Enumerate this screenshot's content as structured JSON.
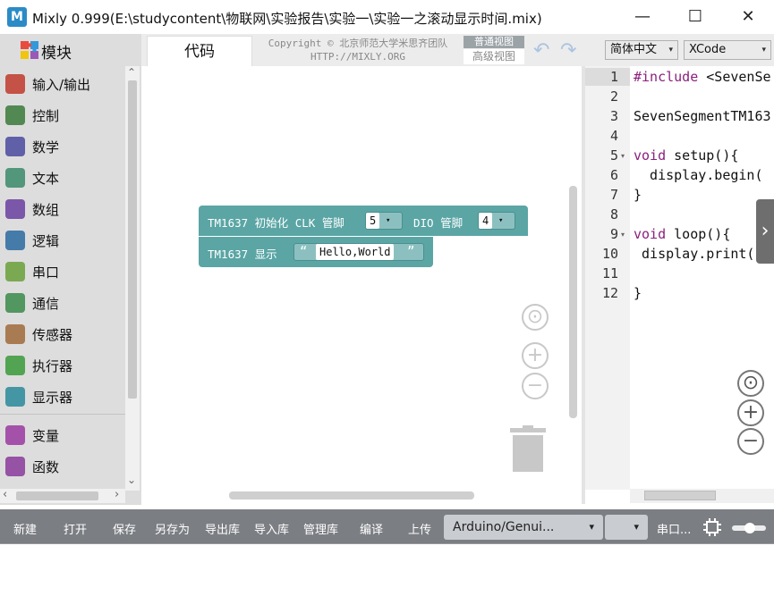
{
  "window": {
    "title": "Mixly 0.999(E:\\studycontent\\物联网\\实验报告\\实验一\\实验一之滚动显示时间.mix)",
    "app_icon": "M",
    "minimize": "—",
    "maximize": "☐",
    "close": "✕"
  },
  "sidebar": {
    "header": "模块",
    "categories": [
      {
        "label": "输入/输出",
        "icon": "io-arrows-icon",
        "color": "#c0392b"
      },
      {
        "label": "控制",
        "icon": "gamepad-icon",
        "color": "#3a7a3a"
      },
      {
        "label": "数学",
        "icon": "sigma-icon",
        "color": "#4a4aa0"
      },
      {
        "label": "文本",
        "icon": "text-t-icon",
        "color": "#3a8a6a"
      },
      {
        "label": "数组",
        "icon": "array-blocks-icon",
        "color": "#6a3fa0"
      },
      {
        "label": "逻辑",
        "icon": "lightbulb-icon",
        "color": "#2a6aa0"
      },
      {
        "label": "串口",
        "icon": "plug-icon",
        "color": "#6aa03a"
      },
      {
        "label": "通信",
        "icon": "satellite-icon",
        "color": "#3a8a4a"
      },
      {
        "label": "传感器",
        "icon": "sensor-wave-icon",
        "color": "#a06a3a"
      },
      {
        "label": "执行器",
        "icon": "actuator-icon",
        "color": "#3a9a3a"
      },
      {
        "label": "显示器",
        "icon": "monitor-icon",
        "color": "#2a8a9a"
      },
      {
        "label": "变量",
        "icon": "variable-cube-icon",
        "color": "#9a3aa0"
      },
      {
        "label": "函数",
        "icon": "function-xy-icon",
        "color": "#8a3a9a"
      }
    ],
    "scroll_up": "⌃",
    "scroll_down": "⌄",
    "scroll_left": "‹",
    "scroll_right": "›"
  },
  "tabs": {
    "code": "代码",
    "copyright_line1": "Copyright © 北京师范大学米思齐团队",
    "copyright_line2": "HTTP://MIXLY.ORG",
    "view_normal": "普通视图",
    "view_advanced": "高级视图",
    "undo": "↶",
    "redo": "↷"
  },
  "blocks": {
    "init": {
      "prefix": "TM1637 初始化 CLK 管脚",
      "clk_value": "5",
      "dio_label": "DIO 管脚",
      "dio_value": "4",
      "caret": "▾"
    },
    "display": {
      "prefix": "TM1637 显示",
      "open_quote": "“",
      "text": "Hello,World",
      "close_quote": "”"
    }
  },
  "workspace_controls": {
    "center": "⊙",
    "zoom_in": "+",
    "zoom_out": "−"
  },
  "code_panel": {
    "language": "简体中文",
    "theme": "XCode",
    "caret": "▾",
    "line_numbers": [
      "1",
      "2",
      "3",
      "4",
      "5",
      "6",
      "7",
      "8",
      "9",
      "10",
      "11",
      "12"
    ],
    "lines": [
      {
        "keyword": "#include",
        "rest": " <SevenSe"
      },
      {
        "keyword": "",
        "rest": ""
      },
      {
        "keyword": "",
        "rest": "SevenSegmentTM163"
      },
      {
        "keyword": "",
        "rest": ""
      },
      {
        "keyword": "void",
        "rest": " setup(){"
      },
      {
        "keyword": "",
        "rest": "  display.begin("
      },
      {
        "keyword": "",
        "rest": "}"
      },
      {
        "keyword": "",
        "rest": ""
      },
      {
        "keyword": "void",
        "rest": " loop(){"
      },
      {
        "keyword": "",
        "rest": " display.print(\""
      },
      {
        "keyword": "",
        "rest": ""
      },
      {
        "keyword": "",
        "rest": "}"
      }
    ],
    "expand_arrow": "›",
    "controls": {
      "center": "⊙",
      "zoom_in": "+",
      "zoom_out": "−"
    }
  },
  "toolbar": {
    "new": "新建",
    "open": "打开",
    "save": "保存",
    "save_as": "另存为",
    "export_lib": "导出库",
    "import_lib": "导入库",
    "manage_lib": "管理库",
    "compile": "编译",
    "upload": "上传",
    "board": "Arduino/Genui...",
    "board_caret": "▾",
    "port_caret": "▾",
    "serial": "串口..."
  },
  "colors": {
    "block": "#5ba5a5",
    "toolbar": "#7b7e83",
    "keyword": "#8a1f7d"
  }
}
